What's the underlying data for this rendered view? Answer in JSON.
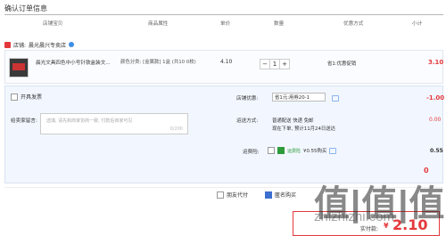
{
  "title": "确认订单信息",
  "headers": [
    "店铺宝贝",
    "商品属性",
    "单价",
    "数量",
    "优惠方式",
    "小计"
  ],
  "shop": {
    "label": "店铺:",
    "name": "晨光晨兴专卖店"
  },
  "item": {
    "name": "晨光文具四色中小号针铁盒装文...",
    "attrs": "颜色分类: [金属款] 1盒 (共10 0枚)",
    "price": "4.10",
    "qty": "1",
    "promo": "省1:优惠促销",
    "subtotal": "3.10"
  },
  "invoice_label": "开具发票",
  "memo": {
    "label": "给卖家留言:",
    "placeholder": "选填, 请先和商家协商一致, 付款后商家可见",
    "counter": "0/200"
  },
  "coupon": {
    "label": "店铺优惠:",
    "value": "省1元:用券20-1",
    "amount": "-1.00"
  },
  "shipping": {
    "label": "运送方式:",
    "line1": "普通配送 快递 免邮",
    "line2": "现在下单, 预计11月24日送达",
    "amount": "0.00"
  },
  "insurance": {
    "label": "运费险:",
    "tag": "运费险",
    "value": "¥0.55购买",
    "amount": "0.55"
  },
  "store_total": {
    "partial": "0"
  },
  "options": {
    "friend_pay": "朋友代付",
    "anonymous": "匿名购买"
  },
  "payment": {
    "label": "实付款:",
    "currency": "¥",
    "amount": "2.10"
  },
  "watermark": {
    "big": "值|值|值",
    "small": "zhizhizhi.com"
  }
}
